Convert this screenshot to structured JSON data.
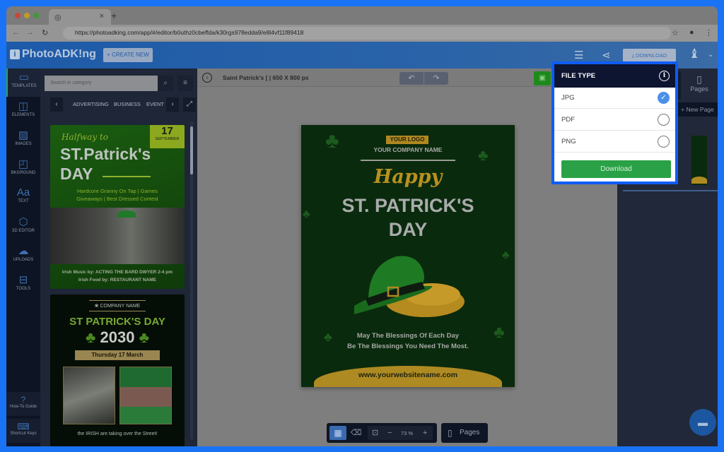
{
  "browser": {
    "tab_close": "×",
    "new_tab": "+",
    "url": "https://photoadking.com/app/#/editor/b0uthz0cbeffda/k30rgs978edda9/e8l4vf11f89418"
  },
  "app": {
    "logo_text": "PhotoADK!ng",
    "create_new_label": "+ CREATE NEW",
    "download_label": "DOWNLOAD"
  },
  "left_nav": {
    "items": [
      {
        "label": "TEMPLATES",
        "icon": "template-icon",
        "glyph": "▭"
      },
      {
        "label": "ELEMENTS",
        "icon": "shapes-icon",
        "glyph": "◫"
      },
      {
        "label": "IMAGES",
        "icon": "image-icon",
        "glyph": "▨"
      },
      {
        "label": "BKGROUND",
        "icon": "background-icon",
        "glyph": "◰"
      },
      {
        "label": "TEXT",
        "icon": "text-icon",
        "glyph": "Aa"
      },
      {
        "label": "3D EDITOR",
        "icon": "cube-icon",
        "glyph": "⬡"
      },
      {
        "label": "UPLOADS",
        "icon": "cloud-upload-icon",
        "glyph": "☁"
      },
      {
        "label": "TOOLS",
        "icon": "toolbox-icon",
        "glyph": "⊟"
      }
    ],
    "bottom": [
      {
        "label": "How-To Guide",
        "icon": "help-icon",
        "glyph": "?"
      },
      {
        "label": "Shortcut Keys",
        "icon": "keyboard-icon",
        "glyph": "⌨"
      }
    ]
  },
  "template_panel": {
    "search_placeholder": "Search in category",
    "categories": [
      "ADVERTISING",
      "BUSINESS",
      "EVENT"
    ],
    "template1": {
      "script": "Halfway to",
      "title1": "ST.Patrick's",
      "title2": "DAY",
      "date_num": "17",
      "date_month": "SEPTEMBER",
      "line1": "Hardcore Granny On Tap | Games",
      "line2": "Giveaways |  Best Dressed Contest",
      "foot1": "Irish Music by: ACTING THE BARD DWYER  2-4 pm",
      "foot2": "Irish Food by: RESTAURANT NAME"
    },
    "template2": {
      "company": "COMPANY NAME",
      "title": "ST PATRICK'S DAY",
      "year": "2030",
      "date": "Thursday 17 March",
      "caption": "the IRISH are taking over the Street!"
    }
  },
  "canvas_toolbar": {
    "doc_title": "Saint Patrick's [ | 650 X 800 px",
    "undo": "↶",
    "redo": "↷"
  },
  "poster": {
    "logo": "YOUR LOGO",
    "company": "YOUR COMPANY NAME",
    "happy": "Happy",
    "title1": "ST. PATRICK'S",
    "title2": "DAY",
    "bless1": "May The Blessings Of Each Day",
    "bless2": "Be The Blessings You Need The Most.",
    "website": "www.yourwebsitename.com"
  },
  "bottom_toolbar": {
    "zoom": "73 %",
    "minus": "−",
    "plus": "+",
    "pages_label": "Pages"
  },
  "right_panel": {
    "pages_tab": "Pages",
    "new_page": "+ New Page"
  },
  "download_popup": {
    "title": "FILE TYPE",
    "options": [
      {
        "label": "JPG",
        "selected": true
      },
      {
        "label": "PDF",
        "selected": false
      },
      {
        "label": "PNG",
        "selected": false
      }
    ],
    "download_label": "Download"
  }
}
